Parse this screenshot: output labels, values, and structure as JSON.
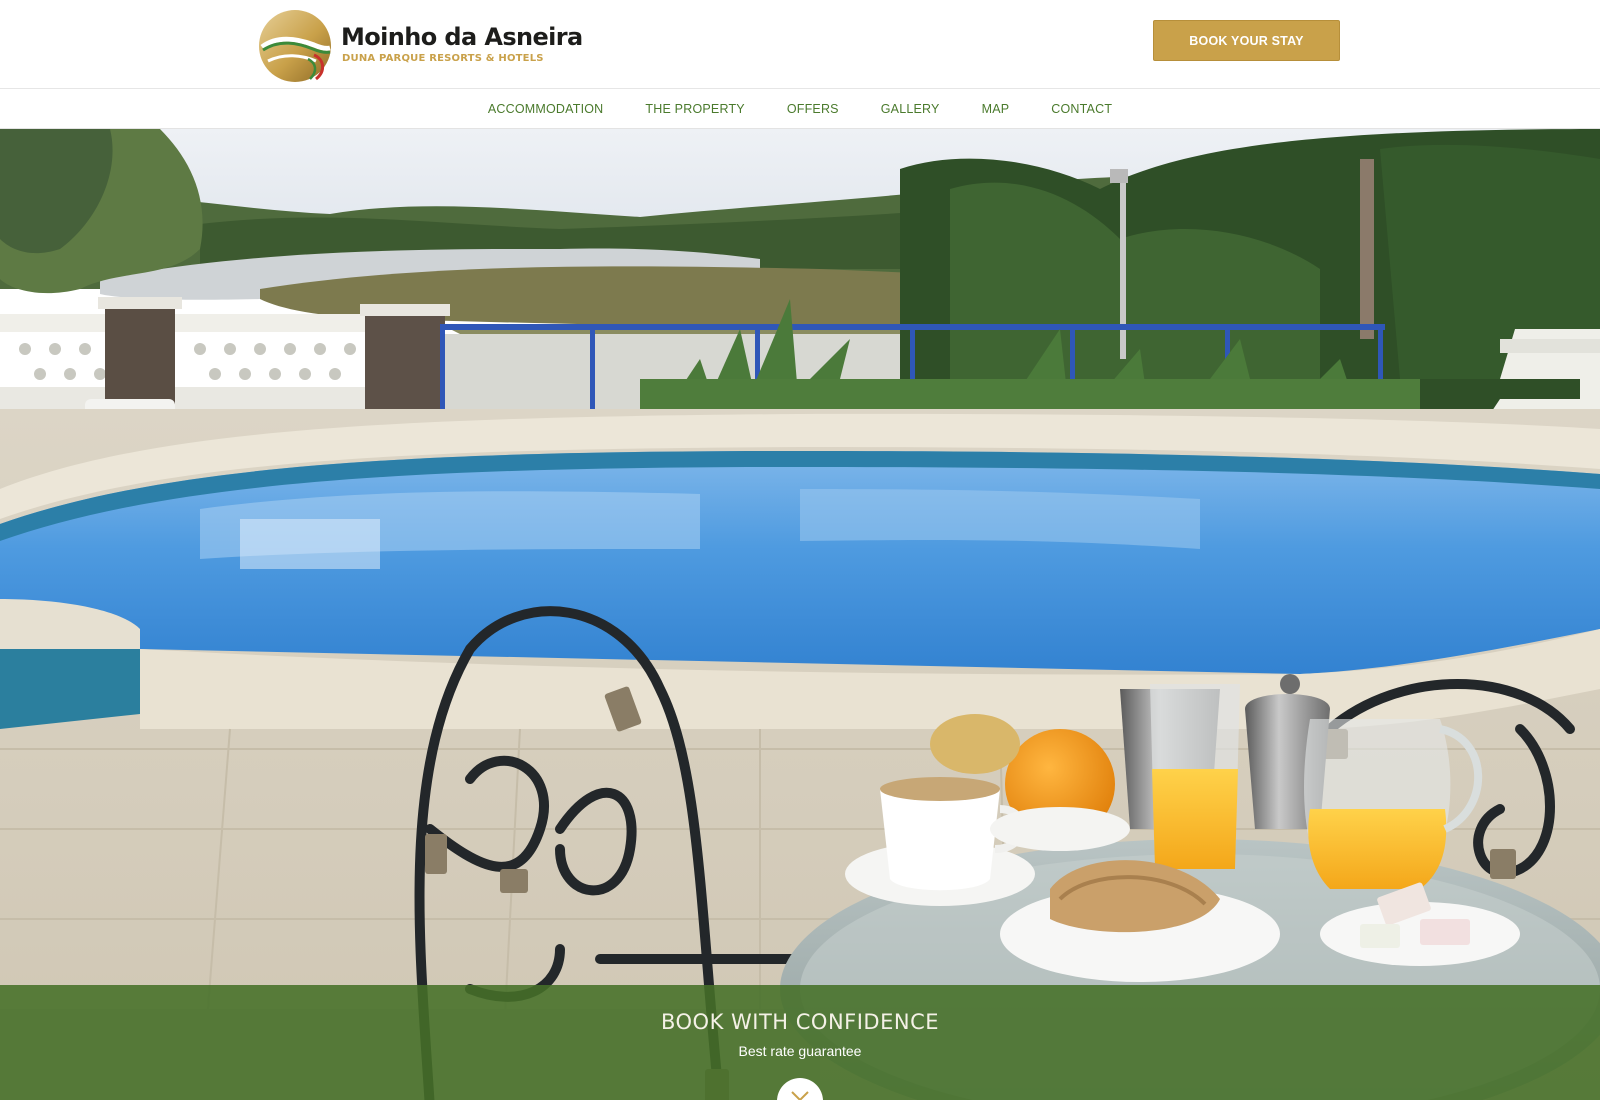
{
  "brand": {
    "name": "Moinho da Asneira",
    "tagline": "DUNA PARQUE RESORTS & HOTELS",
    "colors": {
      "gold": "#c9a14a",
      "green": "#4a7a2c",
      "red": "#c8312b"
    }
  },
  "header": {
    "book_button": "BOOK YOUR STAY"
  },
  "nav": {
    "items": [
      {
        "label": "ACCOMMODATION"
      },
      {
        "label": "THE PROPERTY"
      },
      {
        "label": "OFFERS"
      },
      {
        "label": "GALLERY"
      },
      {
        "label": "MAP"
      },
      {
        "label": "CONTACT"
      }
    ]
  },
  "hero": {
    "image": "pool-breakfast-photo"
  },
  "band": {
    "title": "BOOK WITH CONFIDENCE",
    "subtitle": "Best rate guarantee",
    "scroll_icon": "chevron-down-icon"
  }
}
